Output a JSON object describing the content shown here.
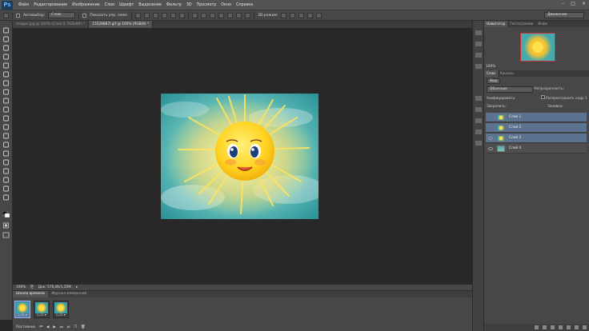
{
  "app": {
    "logo": "Ps"
  },
  "menu": [
    "Файл",
    "Редактирование",
    "Изображение",
    "Слои",
    "Шрифт",
    "Выделение",
    "Фильтр",
    "3D",
    "Просмотр",
    "Окно",
    "Справка"
  ],
  "options": {
    "autoselect_label": "Автовыбор:",
    "autoselect_value": "Слой",
    "show_transform_label": "Показать упр. элем.",
    "workspace": "Движение"
  },
  "tabs": [
    {
      "label": "images.jpg @ 100% (Слой 0, RGB/8#) *",
      "active": false
    },
    {
      "label": "15528887l.gif @ 100% (RGB/8) *",
      "active": true
    }
  ],
  "status": {
    "zoom": "100%",
    "doc": "Док: 576,0K/1,35M"
  },
  "timeline": {
    "tabs": [
      {
        "label": "Шкала времени",
        "active": true
      },
      {
        "label": "Журнал измерений",
        "active": false
      }
    ],
    "frames": [
      {
        "num": "1",
        "delay": "0,15 ▾"
      },
      {
        "num": "2",
        "delay": "0,15 ▾"
      },
      {
        "num": "3",
        "delay": "0,15 ▾"
      }
    ],
    "loop": "Постоянно"
  },
  "navigator": {
    "tabs": [
      {
        "label": "Навигатор",
        "active": true
      },
      {
        "label": "Гистограмма",
        "active": false
      },
      {
        "label": "Инфо",
        "active": false
      }
    ],
    "zoom": "100%"
  },
  "layers": {
    "tabs": [
      {
        "label": "Слои",
        "active": true
      },
      {
        "label": "Каналы",
        "active": false
      }
    ],
    "kind_label": "Вид",
    "blend_mode": "Обычные",
    "opacity_label": "Непрозрачность:",
    "unify_label": "Унифицировать:",
    "propagate_label": "Распространить кадр 1",
    "lock_label": "Закрепить:",
    "fill_label": "Заливка:",
    "items": [
      {
        "name": "Слой 1",
        "selected": true,
        "visible": false
      },
      {
        "name": "Слой 2",
        "selected": true,
        "visible": false
      },
      {
        "name": "Слой 3",
        "selected": true,
        "visible": true
      },
      {
        "name": "Слой 4",
        "selected": false,
        "visible": true
      }
    ]
  },
  "colors": {
    "accent": "#5b7290",
    "sun": "#ffd21f",
    "sky": "#3aa2a8"
  }
}
